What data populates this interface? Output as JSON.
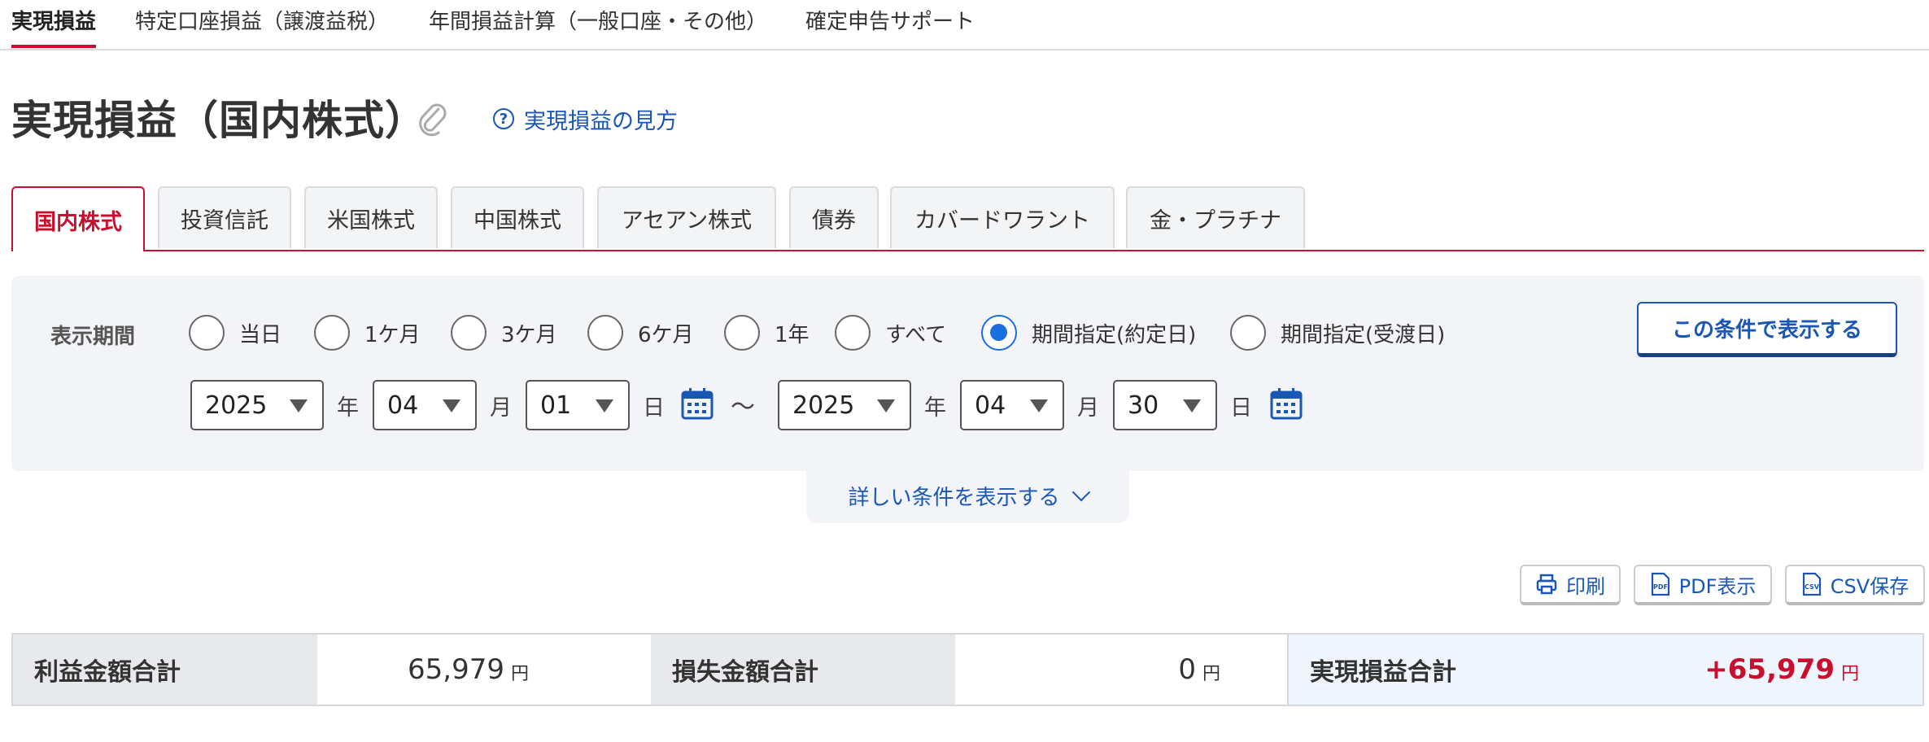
{
  "top_nav": {
    "items": [
      "実現損益",
      "特定口座損益（譲渡益税）",
      "年間損益計算（一般口座・その他）",
      "確定申告サポート"
    ],
    "active_index": 0
  },
  "header": {
    "title": "実現損益（国内株式）",
    "help_link": "実現損益の見方"
  },
  "product_tabs": {
    "items": [
      "国内株式",
      "投資信託",
      "米国株式",
      "中国株式",
      "アセアン株式",
      "債券",
      "カバードワラント",
      "金・プラチナ"
    ],
    "active_index": 0
  },
  "filter": {
    "period_label": "表示期間",
    "options": [
      "当日",
      "1ケ月",
      "3ケ月",
      "6ケ月",
      "1年",
      "すべて",
      "期間指定(約定日)",
      "期間指定(受渡日)"
    ],
    "selected_index": 6,
    "submit_label": "この条件で表示する",
    "from": {
      "year": "2025",
      "month": "04",
      "day": "01"
    },
    "to": {
      "year": "2025",
      "month": "04",
      "day": "30"
    },
    "unit_year": "年",
    "unit_month": "月",
    "unit_day": "日",
    "range_sep": "〜",
    "more_conditions": "詳しい条件を表示する"
  },
  "actions": {
    "print": "印刷",
    "pdf": "PDF表示",
    "csv": "CSV保存"
  },
  "summary": {
    "profit_label": "利益金額合計",
    "profit_value": "65,979",
    "loss_label": "損失金額合計",
    "loss_value": "0",
    "total_label": "実現損益合計",
    "total_value": "+65,979",
    "currency": "円"
  },
  "colors": {
    "accent_red": "#c8102e",
    "link_blue": "#1a57b5",
    "radio_blue": "#1a6fe0"
  }
}
